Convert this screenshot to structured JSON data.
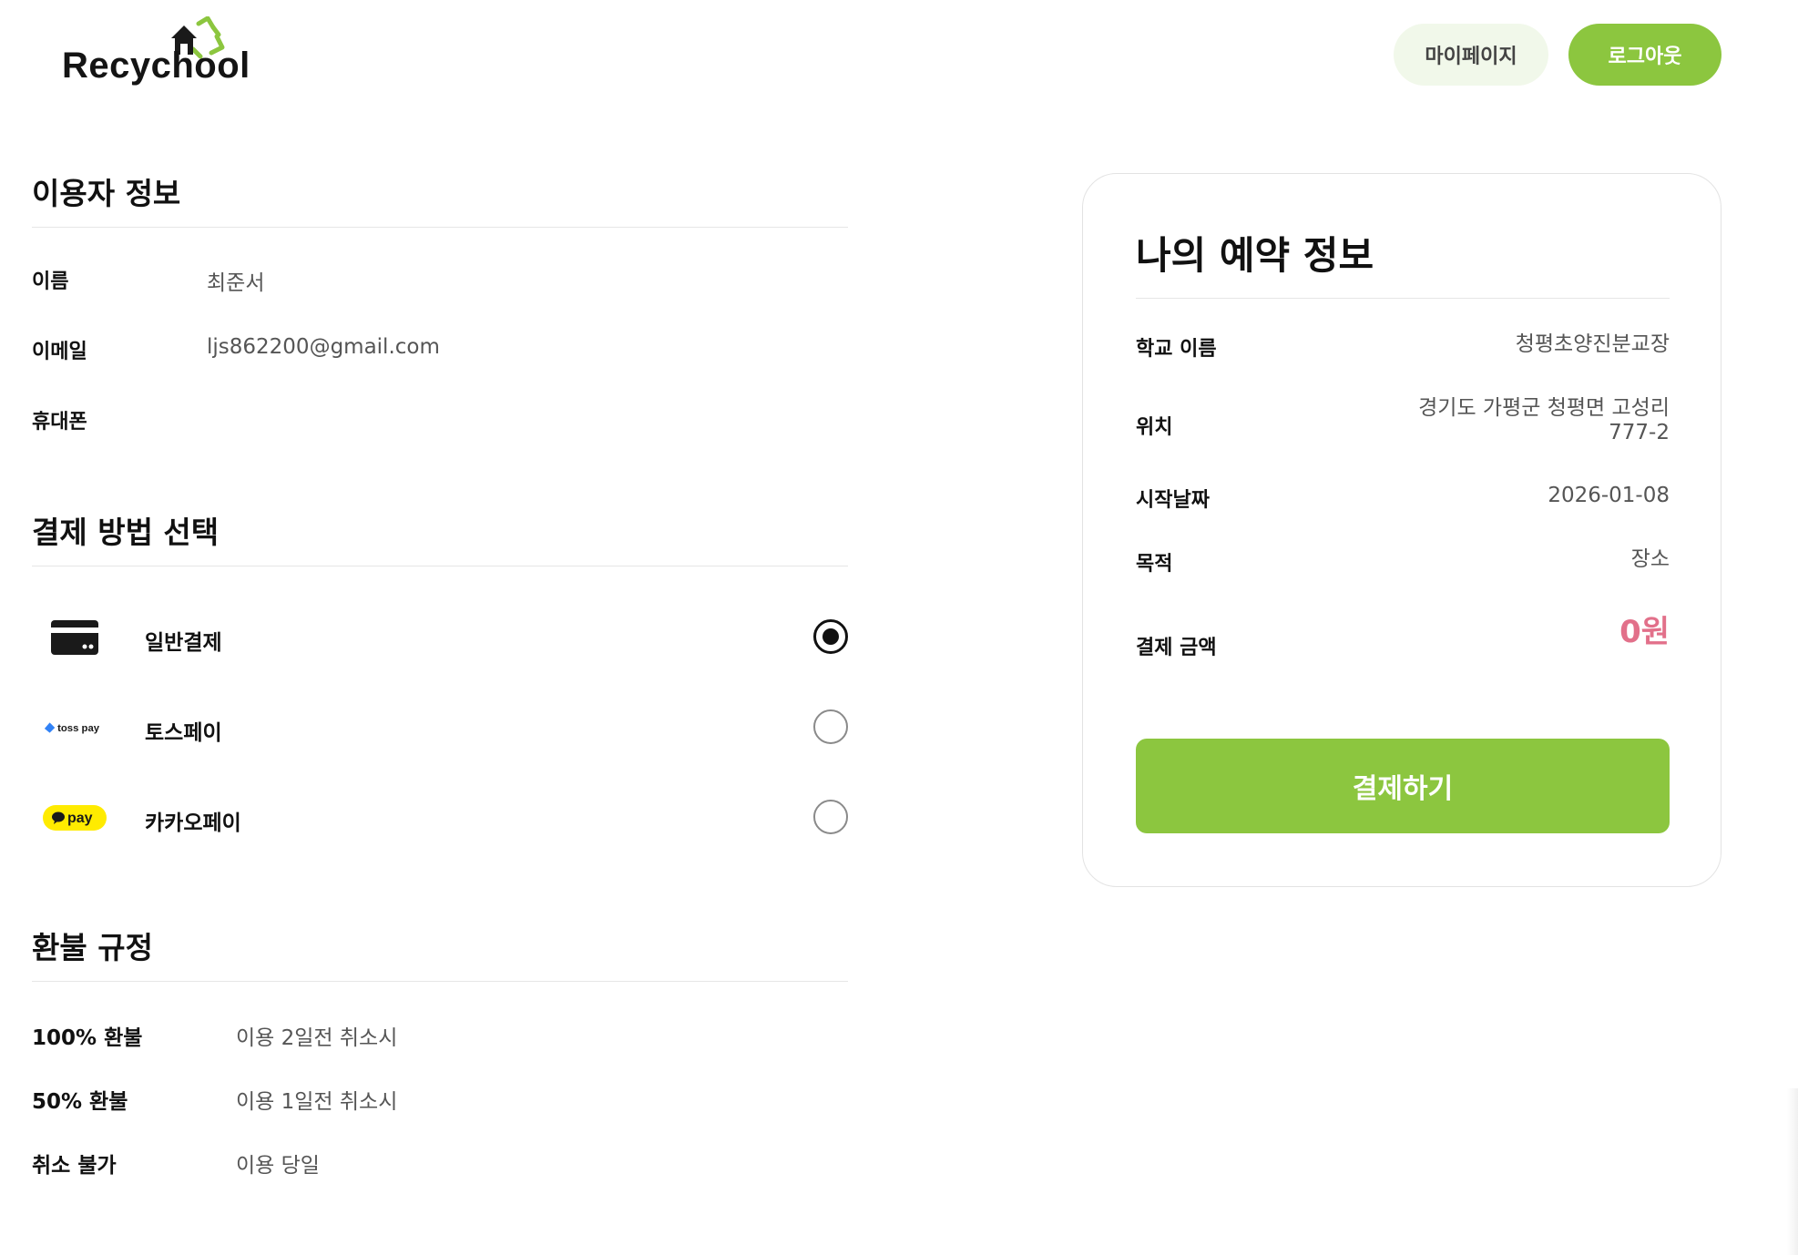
{
  "header": {
    "logo_text": "Recychool",
    "mypage_label": "마이페이지",
    "logout_label": "로그아웃"
  },
  "user_info": {
    "title": "이용자 정보",
    "rows": [
      {
        "label": "이름",
        "value": "최준서"
      },
      {
        "label": "이메일",
        "value": "ljs862200@gmail.com"
      },
      {
        "label": "휴대폰",
        "value": ""
      }
    ]
  },
  "payment": {
    "title": "결제 방법 선택",
    "methods": [
      {
        "label": "일반결제",
        "icon": "credit-card-icon",
        "selected": true
      },
      {
        "label": "토스페이",
        "icon": "tosspay-logo",
        "brand_text": "toss pay",
        "selected": false
      },
      {
        "label": "카카오페이",
        "icon": "kakaopay-logo",
        "brand_text": "pay",
        "selected": false
      }
    ]
  },
  "refund": {
    "title": "환불 규정",
    "rows": [
      {
        "label": "100% 환불",
        "value": "이용 2일전 취소시"
      },
      {
        "label": "50% 환불",
        "value": "이용 1일전 취소시"
      },
      {
        "label": "취소 불가",
        "value": "이용 당일"
      }
    ]
  },
  "reservation": {
    "title": "나의 예약 정보",
    "rows": [
      {
        "label": "학교 이름",
        "value": "청평초양진분교장"
      },
      {
        "label": "위치",
        "value": "경기도 가평군 청평면 고성리\n777-2"
      },
      {
        "label": "시작날짜",
        "value": "2026-01-08"
      },
      {
        "label": "목적",
        "value": "장소"
      }
    ],
    "amount_label": "결제 금액",
    "amount_value": "0원",
    "pay_button_label": "결제하기"
  },
  "colors": {
    "accent": "#8cc63f",
    "accent_soft": "#f1f8ea",
    "amount": "#e2708a",
    "toss_blue": "#3182f6",
    "kakao_yellow": "#ffeb00"
  }
}
